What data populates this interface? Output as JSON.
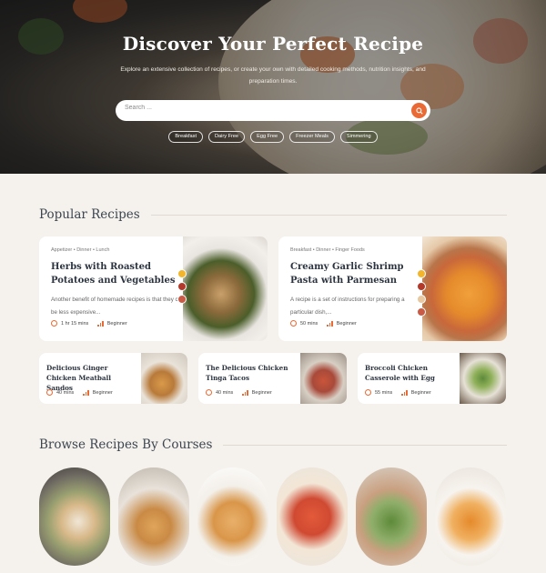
{
  "hero": {
    "title": "Discover Your Perfect Recipe",
    "subtitle": "Explore an extensive collection of recipes, or create your own with detailed cooking methods, nutrition insights, and preparation times.",
    "search_placeholder": "Search ...",
    "chips": [
      "Breakfast",
      "Dairy Free",
      "Egg Free",
      "Freezer Meals",
      "Simmering"
    ]
  },
  "popular": {
    "heading": "Popular Recipes",
    "featured": [
      {
        "meta": "Appetizer  •  Dinner  •  Lunch",
        "title": "Herbs with Roasted Potatoes and Vegetables",
        "description": "Another benefit of homemade recipes is that they can be less expensive...",
        "time": "1 hr 15 mins",
        "level": "Beginner"
      },
      {
        "meta": "Breakfast  •  Dinner  •  Finger Foods",
        "title": "Creamy Garlic Shrimp Pasta with Parmesan",
        "description": "A recipe is a set of instructions for preparing a particular dish,...",
        "time": "50 mins",
        "level": "Beginner"
      }
    ],
    "small": [
      {
        "title": "Delicious Ginger Chicken Meatball Sandos",
        "time": "40 mins",
        "level": "Beginner"
      },
      {
        "title": "The Delicious Chicken Tinga Tacos",
        "time": "40 mins",
        "level": "Beginner"
      },
      {
        "title": "Broccoli Chicken Casserole with Egg",
        "time": "55 mins",
        "level": "Beginner"
      }
    ]
  },
  "courses": {
    "heading": "Browse Recipes By Courses"
  },
  "colors": {
    "accent": "#e96a35",
    "heading": "#3c4550",
    "background": "#f5f2ed"
  },
  "icons": [
    "search-icon",
    "clock-icon",
    "difficulty-bars-icon"
  ]
}
